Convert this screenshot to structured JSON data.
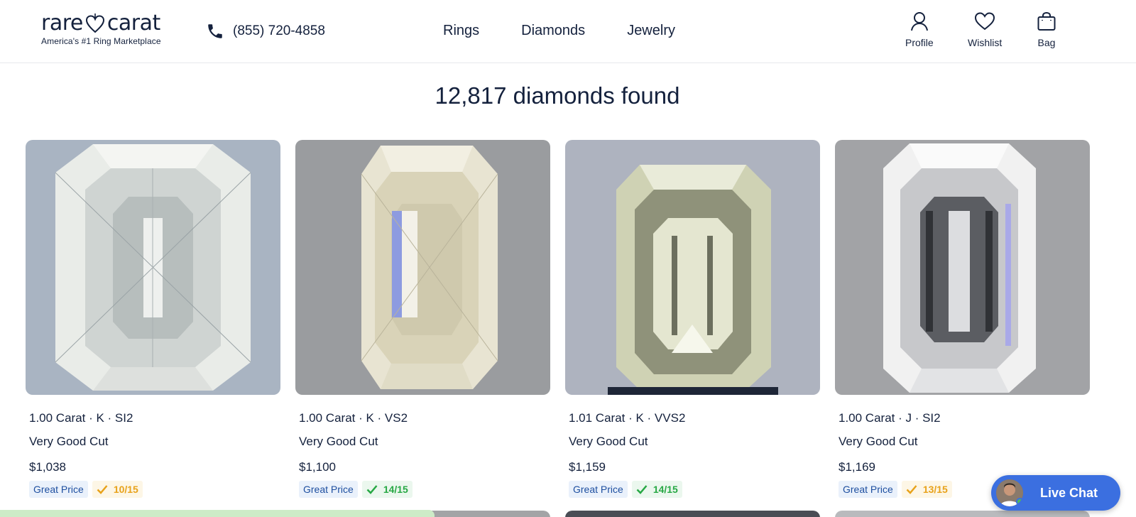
{
  "brand": {
    "name_left": "rare",
    "name_right": "carat",
    "tagline": "America's #1 Ring Marketplace"
  },
  "phone": {
    "number": "(855) 720-4858",
    "icon": "phone-icon"
  },
  "nav": [
    "Rings",
    "Diamonds",
    "Jewelry"
  ],
  "header_actions": [
    {
      "label": "Profile",
      "icon": "profile-icon"
    },
    {
      "label": "Wishlist",
      "icon": "heart-icon"
    },
    {
      "label": "Bag",
      "icon": "bag-icon"
    }
  ],
  "results": {
    "title": "12,817 diamonds found"
  },
  "products": [
    {
      "title": "1.00 Carat · K · SI2",
      "cut": "Very Good Cut",
      "price": "$1,038",
      "badge": "Great Price",
      "score": "10/15",
      "score_color": "#e8a21a",
      "bg": "#a9b4c2"
    },
    {
      "title": "1.00 Carat · K · VS2",
      "cut": "Very Good Cut",
      "price": "$1,100",
      "badge": "Great Price",
      "score": "14/15",
      "score_color": "#27a844",
      "bg": "#9a9c9f"
    },
    {
      "title": "1.01 Carat · K · VVS2",
      "cut": "Very Good Cut",
      "price": "$1,159",
      "badge": "Great Price",
      "score": "14/15",
      "score_color": "#27a844",
      "bg": "#aeb3bf"
    },
    {
      "title": "1.00 Carat · J · SI2",
      "cut": "Very Good Cut",
      "price": "$1,169",
      "badge": "Great Price",
      "score": "13/15",
      "score_color": "#e8a21a",
      "bg": "#a2a3a6"
    }
  ],
  "live_chat": {
    "label": "Live Chat"
  },
  "colors": {
    "navy": "#14213d",
    "accent_blue": "#3b6fe0",
    "badge_blue": "#1e4fa0"
  }
}
